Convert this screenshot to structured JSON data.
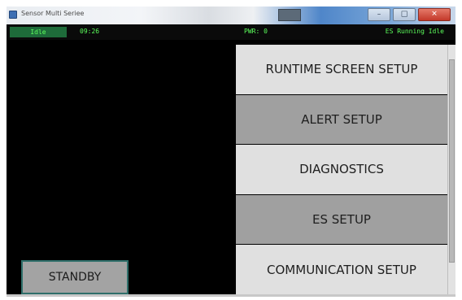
{
  "window": {
    "title": "Sensor Multi Seriee",
    "icon": "app-icon"
  },
  "statusbar": {
    "mode": "Idle",
    "time": "09:26",
    "pressure": "PWR: 0",
    "state": "ES Running Idle"
  },
  "menu": {
    "items": [
      {
        "label": "RUNTIME SCREEN SETUP",
        "tone": "light"
      },
      {
        "label": "ALERT SETUP",
        "tone": "dark"
      },
      {
        "label": "DIAGNOSTICS",
        "tone": "light"
      },
      {
        "label": "ES SETUP",
        "tone": "dark"
      },
      {
        "label": "COMMUNICATION SETUP",
        "tone": "light"
      }
    ]
  },
  "controls": {
    "standby_label": "STANDBY"
  },
  "colors": {
    "status_text": "#5cff5c",
    "panel_background": "#000000",
    "menu_light": "#e0e0e0",
    "menu_dark": "#a0a0a0",
    "standby_border": "#2f6f6a"
  },
  "icons": {
    "minimize": "minimize-icon",
    "maximize": "maximize-icon",
    "close": "close-icon"
  }
}
